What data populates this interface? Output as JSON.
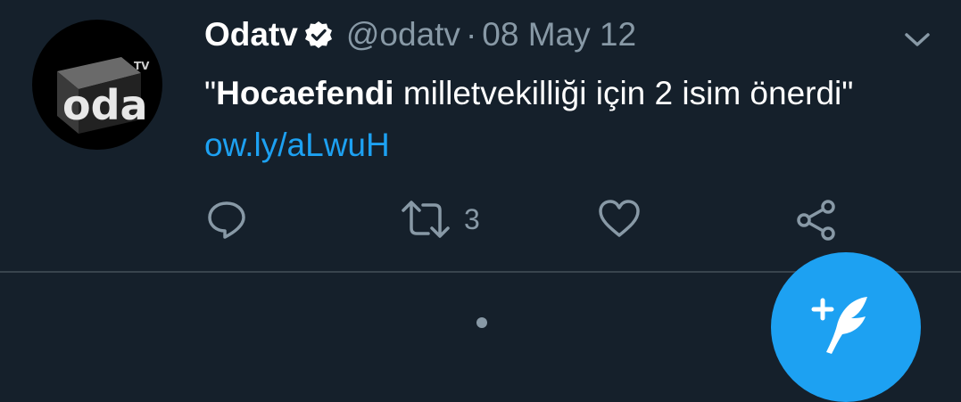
{
  "tweet": {
    "author_name": "Odatv",
    "handle": "@odatv",
    "separator": "·",
    "date": "08 May 12",
    "text_open_quote": "\"",
    "text_bold": "Hocaefendi",
    "text_rest": " milletvekilliği için 2 isim önerdi\" ",
    "link": "ow.ly/aLwuH",
    "avatar_logo_text": "oda",
    "avatar_logo_sup": "TV"
  },
  "actions": {
    "reply_icon": "reply-icon",
    "retweet_icon": "retweet-icon",
    "retweet_count": "3",
    "like_icon": "heart-icon",
    "share_icon": "share-icon"
  },
  "fab": {
    "icon": "compose-tweet-icon"
  },
  "colors": {
    "background": "#15202b",
    "text": "#ffffff",
    "secondary": "#8899a6",
    "accent": "#1da1f2",
    "divider": "#38444d"
  }
}
